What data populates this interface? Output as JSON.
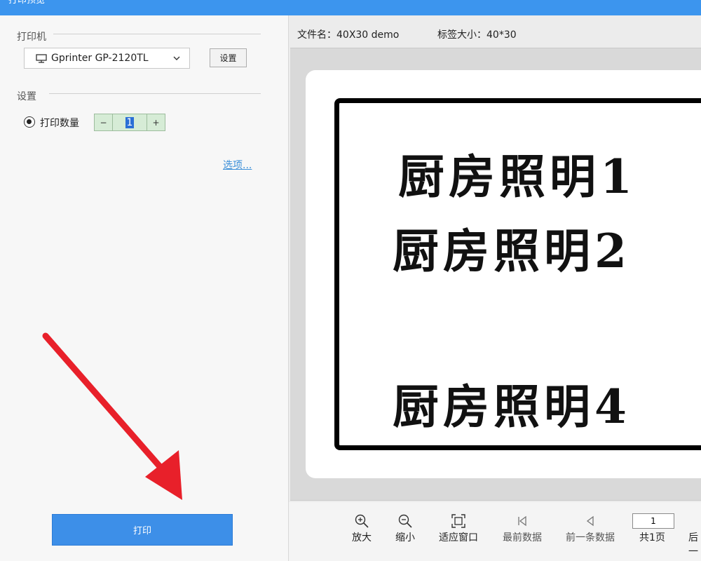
{
  "window": {
    "title": "打印预览"
  },
  "left": {
    "printer_section": "打印机",
    "printer_name": "Gprinter  GP-2120TL",
    "settings_button": "设置",
    "settings_section": "设置",
    "qty_label": "打印数量",
    "qty_minus": "−",
    "qty_value": "1",
    "qty_plus": "+",
    "options_link": "选项...",
    "print_button": "打印"
  },
  "preview": {
    "file_name": "文件名：40X30 demo",
    "label_size": "标签大小：40*30",
    "lines": [
      "厨房照明1",
      "厨房照明2",
      "厨房照明4"
    ]
  },
  "toolbar": {
    "zoom_in": "放大",
    "zoom_out": "缩小",
    "fit_window": "适应窗口",
    "first_data": "最前数据",
    "prev_data": "前一条数据",
    "total_pages": "共1页",
    "next": "后一",
    "page_value": "1"
  },
  "colors": {
    "titlebar": "#3c95ee",
    "print_button": "#3d8fe8",
    "stepper": "#d6ecd6",
    "link": "#3a8ed8",
    "arrow": "#e8202a"
  }
}
